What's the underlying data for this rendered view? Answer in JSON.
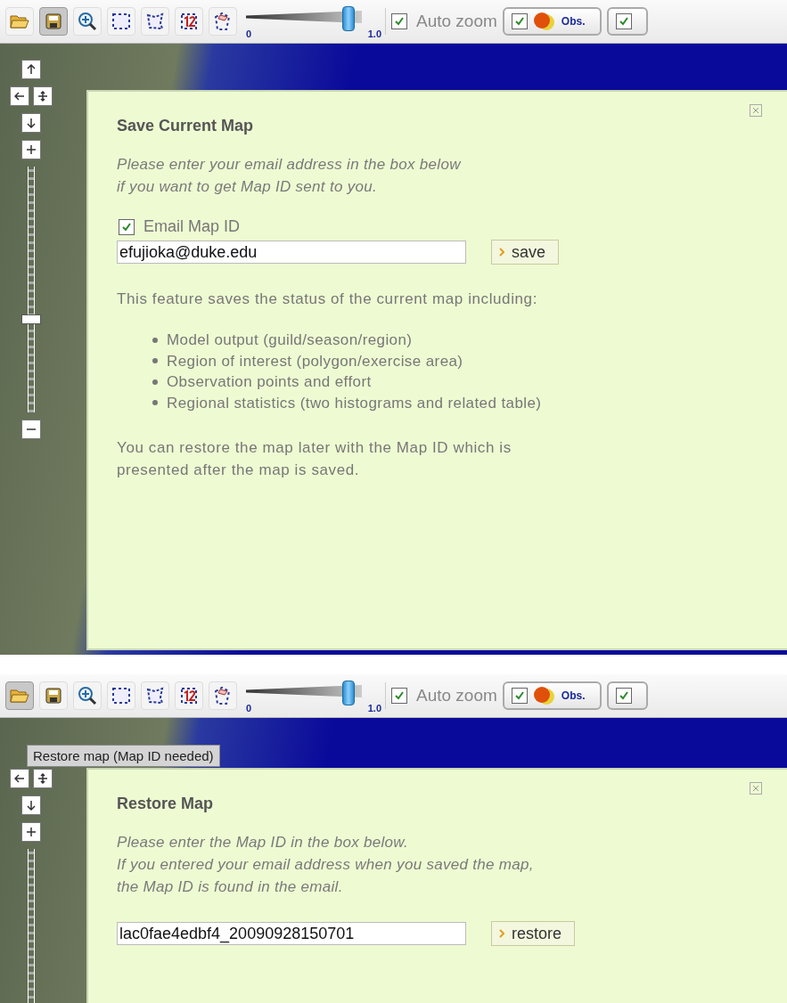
{
  "panels": [
    {
      "toolbar": {
        "tools": [
          {
            "kind": "open",
            "selected": false
          },
          {
            "kind": "save",
            "selected": true
          },
          {
            "kind": "zoom",
            "selected": false
          },
          {
            "kind": "rect",
            "selected": false
          },
          {
            "kind": "polygon",
            "selected": false
          },
          {
            "kind": "numbered",
            "selected": false
          },
          {
            "kind": "region",
            "selected": false
          }
        ],
        "slider": {
          "min_label": "0",
          "max_label": "1.0",
          "level": 0.88
        },
        "auto_zoom": {
          "label": "Auto zoom",
          "checked": true
        },
        "layers": [
          {
            "label": "Obs.",
            "checked": true
          },
          {
            "checked": true
          }
        ]
      },
      "map_controls": [
        {
          "kind": "pan-up"
        },
        {
          "kind": "pan-row"
        },
        {
          "kind": "pan-down"
        },
        {
          "kind": "zoom-in"
        },
        {
          "kind": "zoom-slider",
          "level": 0.38
        },
        {
          "kind": "zoom-out"
        }
      ],
      "dialog": {
        "title": "Save Current Map",
        "intro": [
          "Please enter your email address in the box below",
          "if you want to get Map ID sent to you."
        ],
        "checkbox": {
          "label": "Email Map ID",
          "checked": true
        },
        "input": {
          "value": "efujioka@duke.edu"
        },
        "button": "save",
        "body": "This feature saves the status of the current map including:",
        "bullets": [
          "Model output (guild/season/region)",
          "Region of interest (polygon/exercise area)",
          "Observation points and effort",
          "Regional statistics (two histograms and related table)"
        ],
        "footer": [
          "You can restore the map later with the Map ID which is",
          "presented after the map is saved."
        ]
      }
    },
    {
      "toolbar": {
        "tools": [
          {
            "kind": "open",
            "selected": true
          },
          {
            "kind": "save",
            "selected": false
          },
          {
            "kind": "zoom",
            "selected": false
          },
          {
            "kind": "rect",
            "selected": false
          },
          {
            "kind": "polygon",
            "selected": false
          },
          {
            "kind": "numbered",
            "selected": false
          },
          {
            "kind": "region",
            "selected": false
          }
        ],
        "slider": {
          "min_label": "0",
          "max_label": "1.0",
          "level": 0.88
        },
        "auto_zoom": {
          "label": "Auto zoom",
          "checked": true
        },
        "layers": [
          {
            "label": "Obs.",
            "checked": true
          },
          {
            "checked": true
          }
        ]
      },
      "tooltip": "Restore map (Map ID needed)",
      "map_controls": [
        {
          "kind": "pan-row"
        },
        {
          "kind": "pan-down"
        },
        {
          "kind": "zoom-in"
        },
        {
          "kind": "zoom-track"
        }
      ],
      "dialog": {
        "title": "Restore Map",
        "intro": [
          "Please enter the Map ID in the box below.",
          "If you entered your email address when you saved the map,",
          "the Map ID is found in the email."
        ],
        "input": {
          "value": "lac0fae4edbf4_20090928150701"
        },
        "button": "restore"
      }
    }
  ]
}
